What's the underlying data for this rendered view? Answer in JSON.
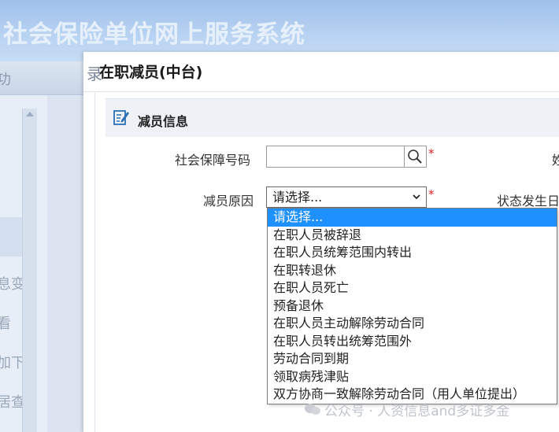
{
  "app": {
    "banner_title": "社会保险单位网上服务系统"
  },
  "sidebar": {
    "header_label": "功",
    "items": [
      "息变",
      "看",
      "加下",
      "居查"
    ]
  },
  "dialog": {
    "edge_char": "录",
    "title": "在职减员(中台)",
    "section_title": "减员信息",
    "fields": {
      "ssn_label": "社会保障号码",
      "ssn_value": "",
      "reason_label": "减员原因",
      "reason_selected": "请选择...",
      "required_mark": "*",
      "right_label_1": "姓",
      "right_label_2": "状态发生日"
    },
    "reason_options": [
      "请选择...",
      "在职人员被辞退",
      "在职人员统筹范围内转出",
      "在职转退休",
      "在职人员死亡",
      "预备退休",
      "在职人员主动解除劳动合同",
      "在职人员转出统筹范围外",
      "劳动合同到期",
      "领取病残津贴",
      "双方协商一致解除劳动合同（用人单位提出）"
    ],
    "selected_option_index": 0
  },
  "watermark": {
    "text": "公众号 · 人资信息and多证多金"
  },
  "colors": {
    "selected_option": "#1e90ff",
    "required": "#e02020",
    "banner": "#9ec0ea"
  },
  "icons": {
    "search": "search-icon",
    "section": "edit-note-icon",
    "select_arrow": "chevron-down-icon"
  }
}
